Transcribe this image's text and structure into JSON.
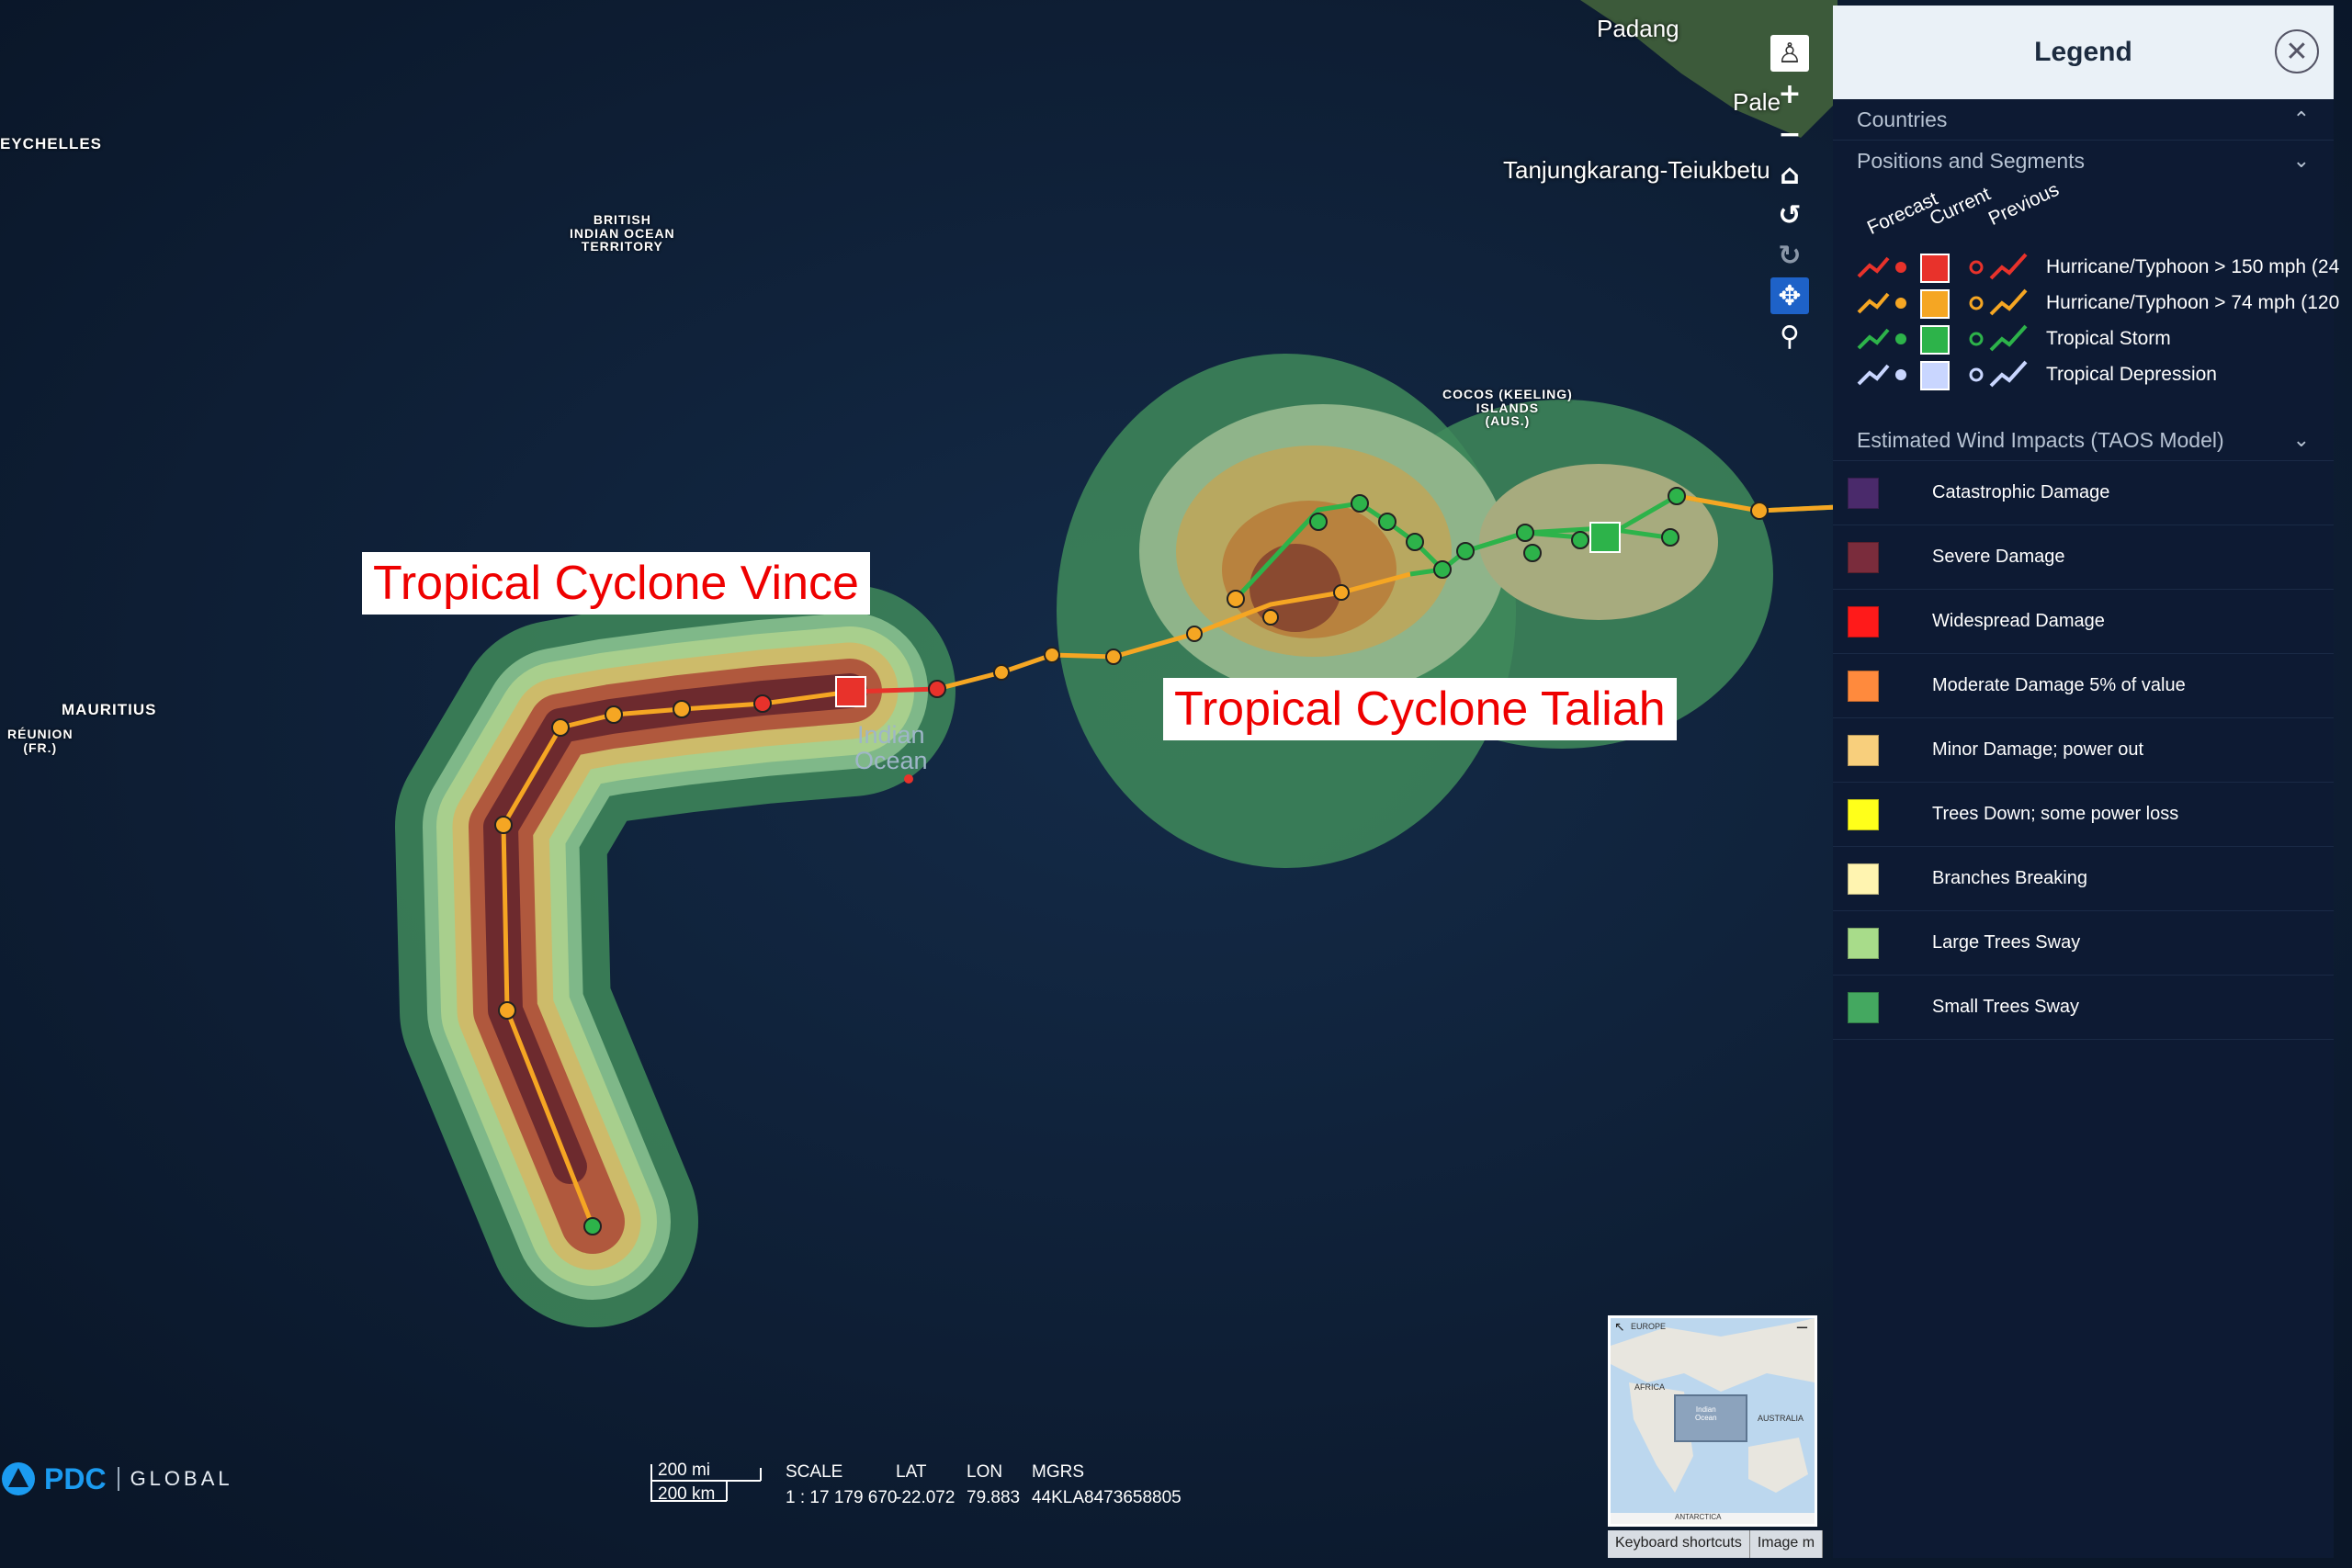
{
  "map": {
    "places": {
      "seychelles": "EYCHELLES",
      "biot": "BRITISH\nINDIAN OCEAN\nTERRITORY",
      "mauritius": "MAURITIUS",
      "reunion": "RÉUNION\n(FR.)",
      "cocos": "COCOS (KEELING)\nISLANDS\n(AUS.)",
      "padang": "Padang",
      "palembang": "Pale",
      "tanjungkarang": "Tanjungkarang-Teiukbetu",
      "ocean": "Indian\nOcean"
    },
    "cyclones": [
      {
        "name": "Tropical Cyclone Vince"
      },
      {
        "name": "Tropical Cyclone Taliah"
      }
    ]
  },
  "toolbar": {
    "icons": [
      "person-icon",
      "zoom-in-icon",
      "zoom-out-icon",
      "home-icon",
      "rotate-left-icon",
      "rotate-right-icon",
      "pan-icon",
      "zoom-box-icon"
    ]
  },
  "legend": {
    "title": "Legend",
    "sections": {
      "countries": "Countries",
      "positions": "Positions and Segments",
      "wind": "Estimated Wind Impacts (TAOS Model)"
    },
    "columns": [
      "Forecast",
      "Current",
      "Previous"
    ],
    "positions": [
      {
        "label": "Hurricane/Typhoon > 150 mph (24",
        "color": "#e8322b"
      },
      {
        "label": "Hurricane/Typhoon > 74 mph (120",
        "color": "#f5a623"
      },
      {
        "label": "Tropical Storm",
        "color": "#2db34a"
      },
      {
        "label": "Tropical Depression",
        "color": "#c9d6ff"
      }
    ],
    "wind_impacts": [
      {
        "label": "Catastrophic Damage",
        "color": "#4a2a6b"
      },
      {
        "label": "Severe Damage",
        "color": "#7a2c3c"
      },
      {
        "label": "Widespread Damage",
        "color": "#ff1a1a"
      },
      {
        "label": "Moderate Damage 5% of value",
        "color": "#ff8a3d"
      },
      {
        "label": "Minor Damage; power out",
        "color": "#f8cf7c"
      },
      {
        "label": "Trees Down; some power loss",
        "color": "#ffff1a"
      },
      {
        "label": "Branches Breaking",
        "color": "#fff4b0"
      },
      {
        "label": "Large Trees Sway",
        "color": "#a8dc8a"
      },
      {
        "label": "Small Trees Sway",
        "color": "#44a860"
      }
    ]
  },
  "status": {
    "logo": "PDC",
    "logo_sub": "GLOBAL",
    "scale_mi": "200 mi",
    "scale_km": "200 km",
    "scale_label": "SCALE",
    "scale_value": "1 : 17 179 670",
    "lat_label": "LAT",
    "lat_value": "-22.072",
    "lon_label": "LON",
    "lon_value": "79.883",
    "mgrs_label": "MGRS",
    "mgrs_value": "44KLA8473658805"
  },
  "minimap": {
    "labels": {
      "europe": "EUROPE",
      "africa": "AFRICA",
      "australia": "AUSTRALIA",
      "ocean": "Indian\nOcean",
      "antarctica": "ANTARCTICA"
    }
  },
  "attribution": {
    "keyboard": "Keyboard shortcuts",
    "image": "Image m"
  }
}
